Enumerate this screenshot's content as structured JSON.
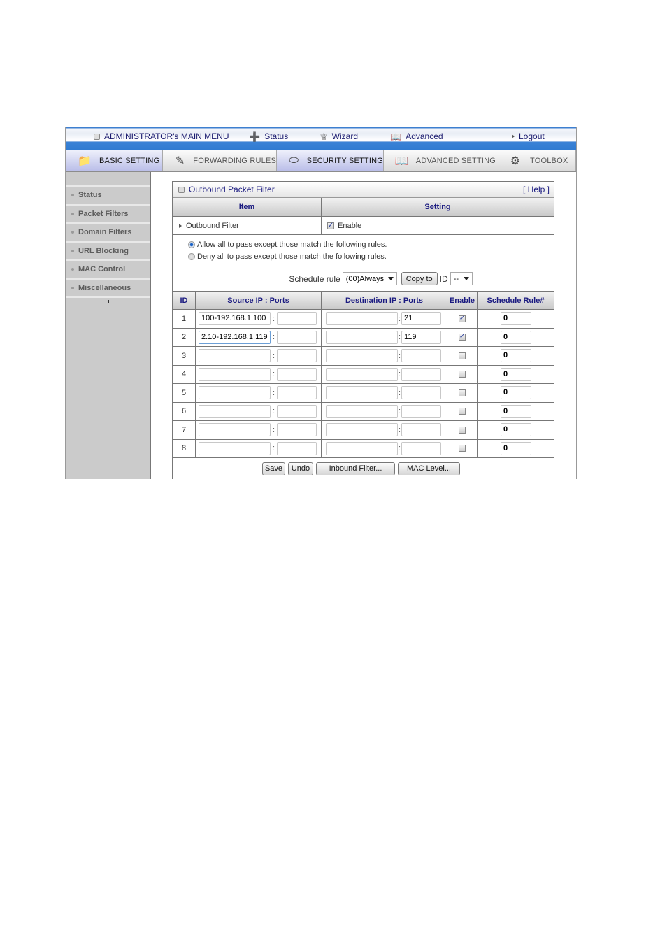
{
  "top_menu": {
    "title": "ADMINISTRATOR's MAIN MENU",
    "items": [
      {
        "label": "Status",
        "icon": "status-icon"
      },
      {
        "label": "Wizard",
        "icon": "wizard-icon"
      },
      {
        "label": "Advanced",
        "icon": "advanced-icon"
      },
      {
        "label": "Logout",
        "icon": "arrow-right-icon"
      }
    ]
  },
  "tabs": [
    {
      "label": "BASIC SETTING",
      "icon": "folder-icon",
      "active": true
    },
    {
      "label": "FORWARDING RULES",
      "icon": "forwarding-icon",
      "active": false
    },
    {
      "label": "SECURITY SETTING",
      "icon": "lock-icon",
      "active": true
    },
    {
      "label": "ADVANCED SETTING",
      "icon": "advanced-setting-icon",
      "active": false
    },
    {
      "label": "TOOLBOX",
      "icon": "toolbox-icon",
      "active": false
    }
  ],
  "sidebar": {
    "items": [
      {
        "label": "Status"
      },
      {
        "label": "Packet Filters"
      },
      {
        "label": "Domain Filters"
      },
      {
        "label": "URL Blocking"
      },
      {
        "label": "MAC Control"
      },
      {
        "label": "Miscellaneous"
      }
    ]
  },
  "panel": {
    "title": "Outbound Packet Filter",
    "help": "[ Help ]",
    "header_item": "Item",
    "header_setting": "Setting",
    "filter_label": "Outbound Filter",
    "filter_enable_label": "Enable",
    "filter_enabled": true,
    "radio_allow": "Allow all to pass except those match the following rules.",
    "radio_deny": "Deny all to pass except those match the following rules.",
    "radio_selected": "allow",
    "schedule_label": "Schedule rule",
    "schedule_value": "(00)Always",
    "copy_to_label": "Copy to",
    "id_label": "ID",
    "id_value": "--",
    "columns": [
      "ID",
      "Source IP : Ports",
      "Destination IP : Ports",
      "Enable",
      "Schedule Rule#"
    ],
    "rules": [
      {
        "id": "1",
        "src_ip": "100-192.168.1.100",
        "src_port": "",
        "dst_ip": "",
        "dst_port": "21",
        "enabled": true,
        "schedule": "0"
      },
      {
        "id": "2",
        "src_ip": "2.10-192.168.1.119",
        "src_port": "",
        "dst_ip": "",
        "dst_port": "119",
        "enabled": true,
        "schedule": "0"
      },
      {
        "id": "3",
        "src_ip": "",
        "src_port": "",
        "dst_ip": "",
        "dst_port": "",
        "enabled": false,
        "schedule": "0"
      },
      {
        "id": "4",
        "src_ip": "",
        "src_port": "",
        "dst_ip": "",
        "dst_port": "",
        "enabled": false,
        "schedule": "0"
      },
      {
        "id": "5",
        "src_ip": "",
        "src_port": "",
        "dst_ip": "",
        "dst_port": "",
        "enabled": false,
        "schedule": "0"
      },
      {
        "id": "6",
        "src_ip": "",
        "src_port": "",
        "dst_ip": "",
        "dst_port": "",
        "enabled": false,
        "schedule": "0"
      },
      {
        "id": "7",
        "src_ip": "",
        "src_port": "",
        "dst_ip": "",
        "dst_port": "",
        "enabled": false,
        "schedule": "0"
      },
      {
        "id": "8",
        "src_ip": "",
        "src_port": "",
        "dst_ip": "",
        "dst_port": "",
        "enabled": false,
        "schedule": "0"
      }
    ],
    "buttons": {
      "save": "Save",
      "undo": "Undo",
      "inbound": "Inbound Filter...",
      "mac_level": "MAC Level..."
    }
  }
}
